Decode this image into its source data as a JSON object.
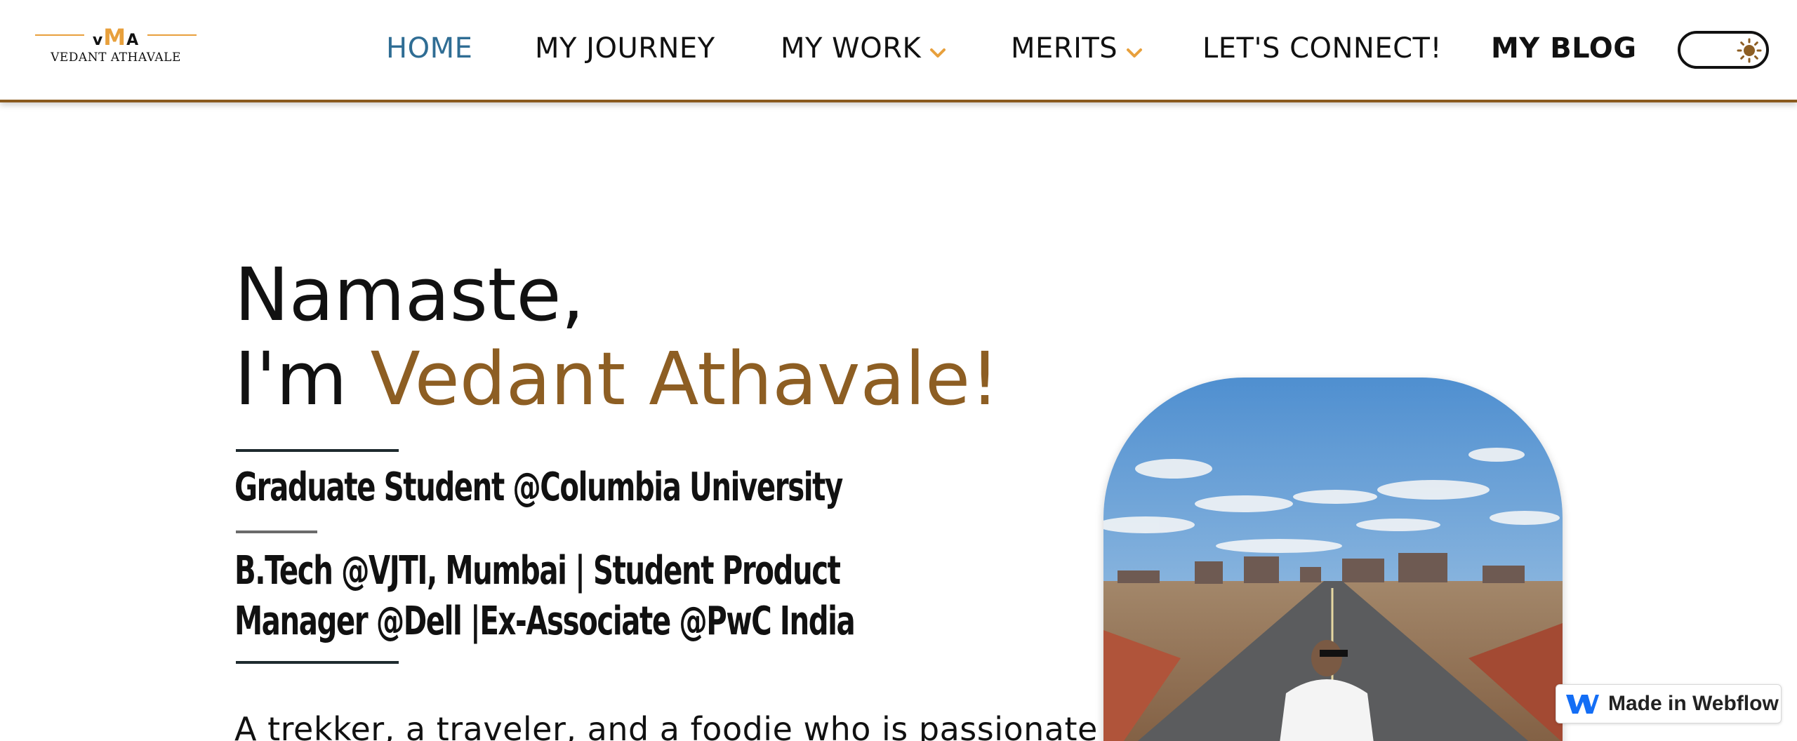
{
  "logo": {
    "mark_left": "v",
    "mark_middle": "M",
    "mark_right": "A",
    "name": "VEDANT ATHAVALE"
  },
  "nav": {
    "home": "HOME",
    "journey": "MY JOURNEY",
    "work": "MY WORK",
    "merits": "MERITS",
    "connect": "LET'S CONNECT!",
    "blog": "MY BLOG",
    "dropdown_icon": "chevron-down-icon",
    "theme_toggle_icon": "sun-icon"
  },
  "hero": {
    "greeting": "Namaste,",
    "intro_prefix": "I'm ",
    "intro_name": "Vedant Athavale!",
    "subtitle_1": "Graduate Student @Columbia University",
    "subtitle_2": "B.Tech @VJTI, Mumbai | Student Product Manager @Dell |Ex-Associate @PwC India",
    "bio_start": "A trekker, a traveler, and a foodie who is passionate"
  },
  "badge": {
    "label": "Made in Webflow",
    "icon": "webflow-logo-icon"
  },
  "colors": {
    "accent": "#8d5e23",
    "logo_orange": "#e8a03c",
    "nav_active": "#2f6d94",
    "header_border": "#8a5a1e",
    "chevron": "#e8a03c"
  }
}
